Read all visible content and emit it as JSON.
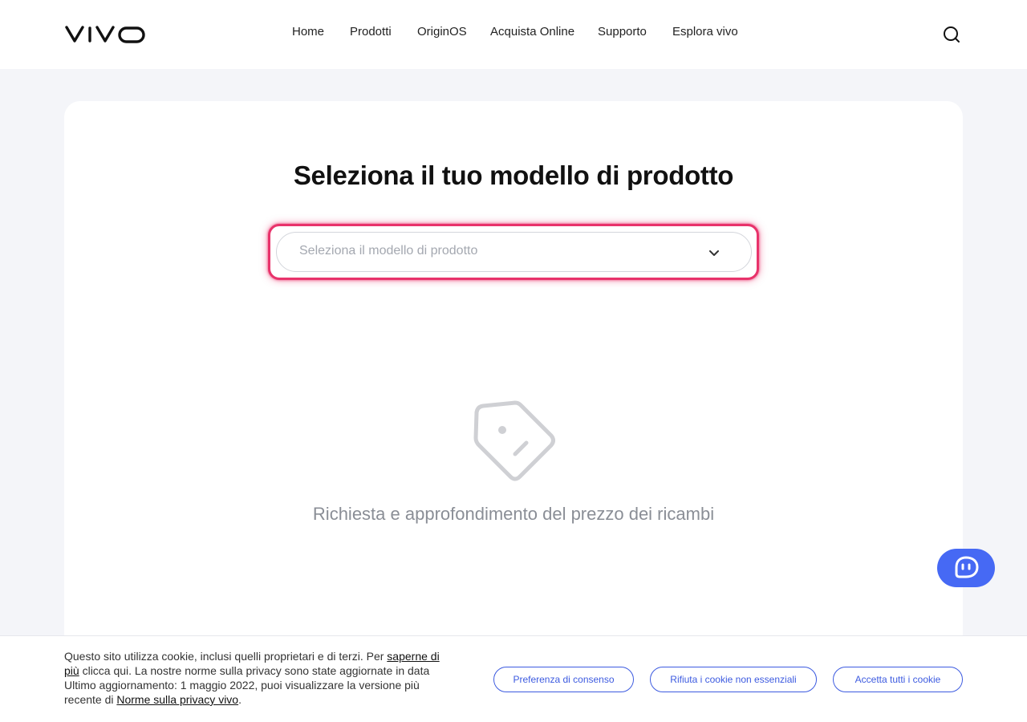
{
  "header": {
    "logo_text": "vivo",
    "nav": [
      {
        "label": "Home"
      },
      {
        "label": "Prodotti"
      },
      {
        "label": "OriginOS"
      },
      {
        "label": "Acquista Online"
      },
      {
        "label": "Supporto"
      },
      {
        "label": "Esplora vivo"
      }
    ],
    "search_icon": "search-icon"
  },
  "main": {
    "title": "Seleziona il tuo modello di prodotto",
    "select": {
      "placeholder": "Seleziona il modello di prodotto",
      "icon": "chevron-down-icon",
      "highlight_color": "#e8336b"
    },
    "empty_state": {
      "icon": "price-tag-icon",
      "text": "Richiesta e approfondimento del prezzo dei ricambi"
    },
    "chat_button": {
      "icon": "chat-bot-icon",
      "color": "#4669f4"
    }
  },
  "cookie_bar": {
    "text_1": "Questo sito utilizza cookie, inclusi quelli proprietari e di terzi. Per ",
    "link_1": "saperne di più",
    "text_2": " clicca qui. La nostre norme sulla privacy sono state aggiornate in data Ultimo aggiornamento: 1 maggio 2022, puoi visualizzare la versione più recente di ",
    "link_2": "Norme sulla privacy vivo",
    "text_3": ".",
    "buttons": [
      {
        "label": "Preferenza di consenso"
      },
      {
        "label": "Rifiuta i cookie non essenziali"
      },
      {
        "label": "Accetta tutti i cookie"
      }
    ],
    "accent_color": "#3d5be0"
  }
}
